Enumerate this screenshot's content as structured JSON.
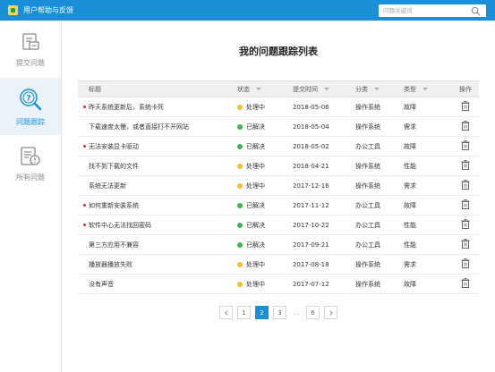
{
  "app": {
    "title": "用户帮助与反馈"
  },
  "search": {
    "placeholder": "问题关键词"
  },
  "sidebar": {
    "items": [
      {
        "label": "提交问题",
        "icon": "submit-issue-icon",
        "active": false
      },
      {
        "label": "问题跟踪",
        "icon": "track-issue-icon",
        "active": true
      },
      {
        "label": "所有问题",
        "icon": "all-issues-icon",
        "active": false
      }
    ]
  },
  "main": {
    "title": "我的问题跟踪列表",
    "columns": [
      "标题",
      "状态",
      "提交时间",
      "分类",
      "类型",
      "操作"
    ],
    "rows": [
      {
        "title": "昨天系统更新后，系统卡死",
        "flag": true,
        "status": "处理中",
        "date": "2018-05-06",
        "category": "操作系统",
        "type": "故障"
      },
      {
        "title": "下载速度太慢，或者直接打不开网站",
        "flag": false,
        "status": "已解决",
        "date": "2018-05-04",
        "category": "操作系统",
        "type": "需求"
      },
      {
        "title": "无法安装显卡驱动",
        "flag": true,
        "status": "已解决",
        "date": "2018-05-02",
        "category": "办公工具",
        "type": "故障"
      },
      {
        "title": "找不到下载的文件",
        "flag": false,
        "status": "处理中",
        "date": "2018-04-21",
        "category": "操作系统",
        "type": "性能"
      },
      {
        "title": "系统无法更新",
        "flag": false,
        "status": "处理中",
        "date": "2017-12-16",
        "category": "操作系统",
        "type": "需求"
      },
      {
        "title": "如何重新安装系统",
        "flag": true,
        "status": "已解决",
        "date": "2017-11-12",
        "category": "办公工具",
        "type": "故障"
      },
      {
        "title": "软件中心无法找回密码",
        "flag": true,
        "status": "已解决",
        "date": "2017-10-22",
        "category": "办公工具",
        "type": "性能"
      },
      {
        "title": "第三方应用不兼容",
        "flag": false,
        "status": "已解决",
        "date": "2017-09-21",
        "category": "办公工具",
        "type": "性能"
      },
      {
        "title": "播放器播放失败",
        "flag": false,
        "status": "处理中",
        "date": "2017-08-18",
        "category": "操作系统",
        "type": "需求"
      },
      {
        "title": "没有声音",
        "flag": false,
        "status": "处理中",
        "date": "2017-07-12",
        "category": "操作系统",
        "type": "故障"
      }
    ],
    "status_colors": {
      "处理中": "#f5c02a",
      "已解决": "#3cb44a"
    },
    "flag_color": "#e0252a",
    "row_action_icon": "trash-icon"
  },
  "pagination": {
    "pages": [
      "1",
      "2",
      "3",
      "…",
      "6"
    ],
    "current": "2",
    "prev_icon": "chevron-left-icon",
    "next_icon": "chevron-right-icon"
  },
  "colors": {
    "accent": "#1a8fd8",
    "titlebar": "#1a8fd8",
    "active_sidebar_bg": "#eaf3fa"
  }
}
